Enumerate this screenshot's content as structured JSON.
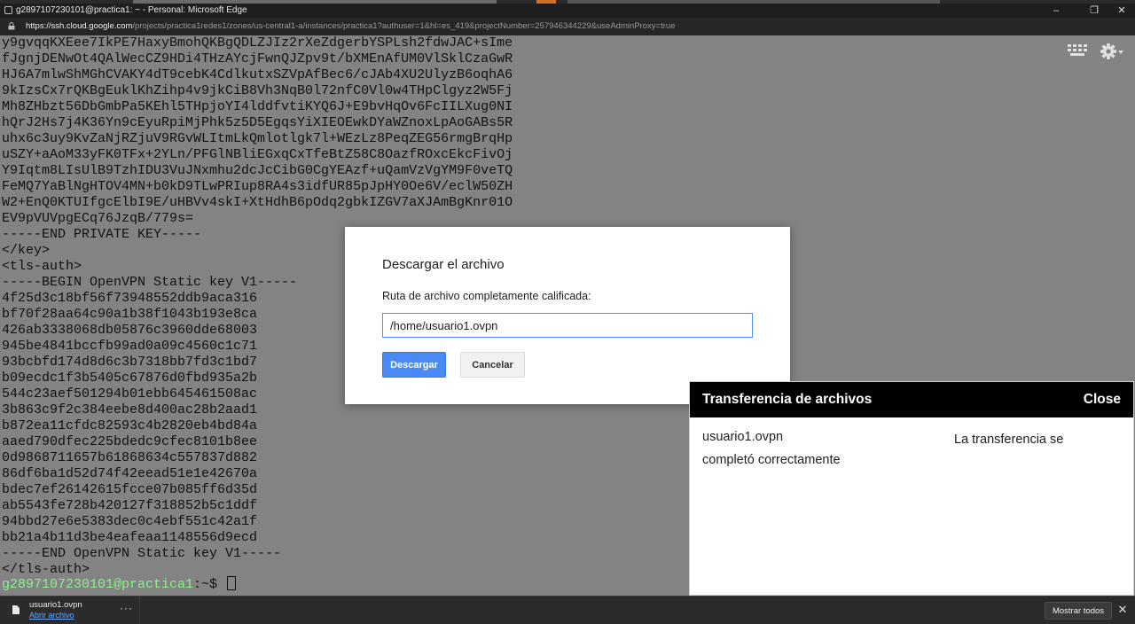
{
  "window": {
    "title": "g2897107230101@practica1: ~ - Personal: Microsoft Edge",
    "minimize_glyph": "–",
    "maximize_glyph": "❐",
    "close_glyph": "✕"
  },
  "address_bar": {
    "url_host": "https://ssh.cloud.google.com",
    "url_path": "/projects/practica1redes1/zones/us-central1-a/instances/practica1?authuser=1&hl=es_419&projectNumber=257946344229&useAdminProxy=true"
  },
  "terminal": {
    "lines": [
      "y9gvqqKXEee7IkPE7HaxyBmohQKBgQDLZJIz2rXeZdgerbYSPLsh2fdwJAC+sIme",
      "fJgnjDENwOt4QAlWecCZ9HDi4THzAYcjFwnQJZpv9t/bXMEnAfUM0VlSklCzaGwR",
      "HJ6A7mlwShMGhCVAKY4dT9cebK4CdlkutxSZVpAfBec6/cJAb4XU2UlyzB6oqhA6",
      "9kIzsCx7rQKBgEuklKhZihp4v9jkCiB8Vh3NqB0l72nfC0Vl0w4THpClgyz2W5Fj",
      "Mh8ZHbzt56DbGmbPa5KEhl5THpjoYI4lddfvtiKYQ6J+E9bvHqOv6FcIILXug0NI",
      "hQrJ2Hs7j4K36Yn9cEyuRpiMjPhk5z5D5EgqsYiXIEOEwkDYaWZnoxLpAoGABs5R",
      "uhx6c3uy9KvZaNjRZjuV9RGvWLItmLkQmlotlgk7l+WEzLz8PeqZEG56rmgBrqHp",
      "uSZY+aAoM33yFK0TFx+2YLn/PFGlNBliEGxqCxTfeBtZ58C8OazfROxcEkcFivOj",
      "Y9Iqtm8LIsUlB9TzhIDU3VuJNxmhu2dcJcCibG0CgYEAzf+uQamVzVgYM9F0veTQ",
      "FeMQ7YaBlNgHTOV4MN+b0kD9TLwPRIup8RA4s3idfUR85pJpHY0Oe6V/eclW50ZH",
      "W2+EnQ0KTUIfgcElbI9E/uHBVv4skI+XtHdhB6pOdq2gbkIZGV7aXJAmBgKnr01O",
      "EV9pVUVpgECq76JzqB/779s=",
      "-----END PRIVATE KEY-----",
      "</key>",
      "<tls-auth>",
      "-----BEGIN OpenVPN Static key V1-----",
      "4f25d3c18bf56f73948552ddb9aca316",
      "bf70f28aa64c90a1b38f1043b193e8ca",
      "426ab3338068db05876c3960dde68003",
      "945be4841bccfb99ad0a09c4560c1c71",
      "93bcbfd174d8d6c3b7318bb7fd3c1bd7",
      "b09ecdc1f3b5405c67876d0fbd935a2b",
      "544c23aef501294b01ebb645461508ac",
      "3b863c9f2c384eebe8d400ac28b2aad1",
      "b872ea11cfdc82593c4b2820eb4bd84a",
      "aaed790dfec225bdedc9cfec8101b8ee",
      "0d9868711657b61868634c557837d882",
      "86df6ba1d52d74f42eead51e1e42670a",
      "bdec7ef26142615fcce07b085ff6d35d",
      "ab5543fe728b420127f318852b5c1ddf",
      "94bbd27e6e5383dec0c4ebf551c42a1f",
      "bb21a4b11d3be4eafeaa1148556d9ecd",
      "-----END OpenVPN Static key V1-----",
      "</tls-auth>"
    ],
    "prompt_user": "g2897107230101@practica1",
    "prompt_rest": ":~$ "
  },
  "dialog": {
    "title": "Descargar el archivo",
    "label": "Ruta de archivo completamente calificada:",
    "input_value": "/home/usuario1.ovpn",
    "download_button": "Descargar",
    "cancel_button": "Cancelar"
  },
  "transfer_panel": {
    "title": "Transferencia de archivos",
    "close_label": "Close",
    "file_name": "usuario1.ovpn",
    "status": "La transferencia se completó correctamente"
  },
  "download_bar": {
    "file_name": "usuario1.ovpn",
    "open_link": "Abrir archivo",
    "more_glyph": "···",
    "show_all_button": "Mostrar todos",
    "close_glyph": "✕"
  },
  "colors": {
    "terminal_bg": "#838383",
    "prompt_user": "#8cf08c",
    "primary_button": "#4a8af4",
    "transfer_header": "#000000"
  }
}
